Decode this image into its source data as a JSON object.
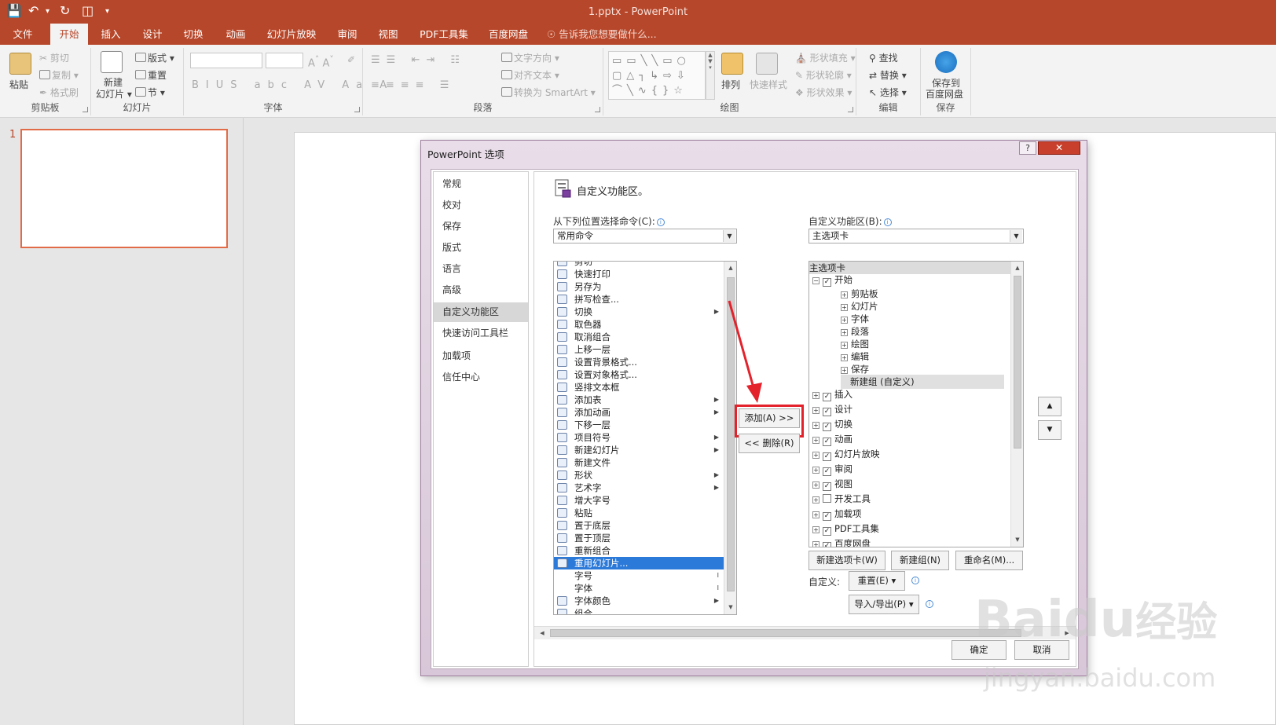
{
  "window": {
    "title": "1.pptx - PowerPoint"
  },
  "tabs": [
    "文件",
    "开始",
    "插入",
    "设计",
    "切换",
    "动画",
    "幻灯片放映",
    "审阅",
    "视图",
    "PDF工具集",
    "百度网盘"
  ],
  "tell_me": "告诉我您想要做什么...",
  "ribbon": {
    "clipboard": {
      "label": "剪贴板",
      "paste": "粘贴",
      "cut": "剪切",
      "copy": "复制",
      "format_painter": "格式刷"
    },
    "slides": {
      "label": "幻灯片",
      "new_slide_1": "新建",
      "new_slide_2": "幻灯片",
      "layout": "版式",
      "reset": "重置",
      "section": "节"
    },
    "font": {
      "label": "字体"
    },
    "paragraph": {
      "label": "段落",
      "text_direction": "文字方向",
      "align_text": "对齐文本",
      "smartart": "转换为 SmartArt"
    },
    "drawing": {
      "label": "绘图",
      "arrange": "排列",
      "quick_styles": "快速样式",
      "shape_fill": "形状填充",
      "shape_outline": "形状轮廓",
      "shape_effects": "形状效果"
    },
    "editing": {
      "label": "编辑",
      "find": "查找",
      "replace": "替换",
      "select": "选择"
    },
    "save": {
      "label": "保存",
      "save_to_1": "保存到",
      "save_to_2": "百度网盘"
    }
  },
  "thumbnail": {
    "number": "1"
  },
  "dialog": {
    "title": "PowerPoint 选项",
    "help": "?",
    "nav": [
      "常规",
      "校对",
      "保存",
      "版式",
      "语言",
      "高级",
      "自定义功能区",
      "快速访问工具栏",
      "加载项",
      "信任中心"
    ],
    "section_title": "自定义功能区。",
    "choose_label": "从下列位置选择命令(C):",
    "choose_value": "常用命令",
    "customize_label": "自定义功能区(B):",
    "customize_value": "主选项卡",
    "commands": [
      "剪切",
      "快速打印",
      "另存为",
      "拼写检查...",
      "切换",
      "取色器",
      "取消组合",
      "上移一层",
      "设置背景格式...",
      "设置对象格式...",
      "竖排文本框",
      "添加表",
      "添加动画",
      "下移一层",
      "项目符号",
      "新建幻灯片",
      "新建文件",
      "形状",
      "艺术字",
      "增大字号",
      "粘贴",
      "置于底层",
      "置于顶层",
      "重新组合",
      "重用幻灯片...",
      "字号",
      "字体",
      "字体颜色",
      "组合"
    ],
    "add_button": "添加(A) >>",
    "remove_button": "<< 删除(R)",
    "tree_header": "主选项卡",
    "tree_root": "开始",
    "tree_groups": [
      "剪贴板",
      "幻灯片",
      "字体",
      "段落",
      "绘图",
      "编辑",
      "保存"
    ],
    "tree_new_group": "新建组 (自定义)",
    "tree_tabs": [
      "插入",
      "设计",
      "切换",
      "动画",
      "幻灯片放映",
      "审阅",
      "视图",
      "开发工具",
      "加载项",
      "PDF工具集",
      "百度网盘"
    ],
    "new_tab_button": "新建选项卡(W)",
    "new_group_button": "新建组(N)",
    "rename_button": "重命名(M)...",
    "customize_row_label": "自定义:",
    "reset_button": "重置(E) ▾",
    "import_export_button": "导入/导出(P) ▾",
    "ok_button": "确定",
    "cancel_button": "取消"
  },
  "watermark": {
    "text1": "Baidu",
    "text2": "经验",
    "url": "jingyan.baidu.com"
  },
  "colors": {
    "accent": "#b7472a",
    "selection": "#2b79d8",
    "highlight": "#e3222c"
  }
}
